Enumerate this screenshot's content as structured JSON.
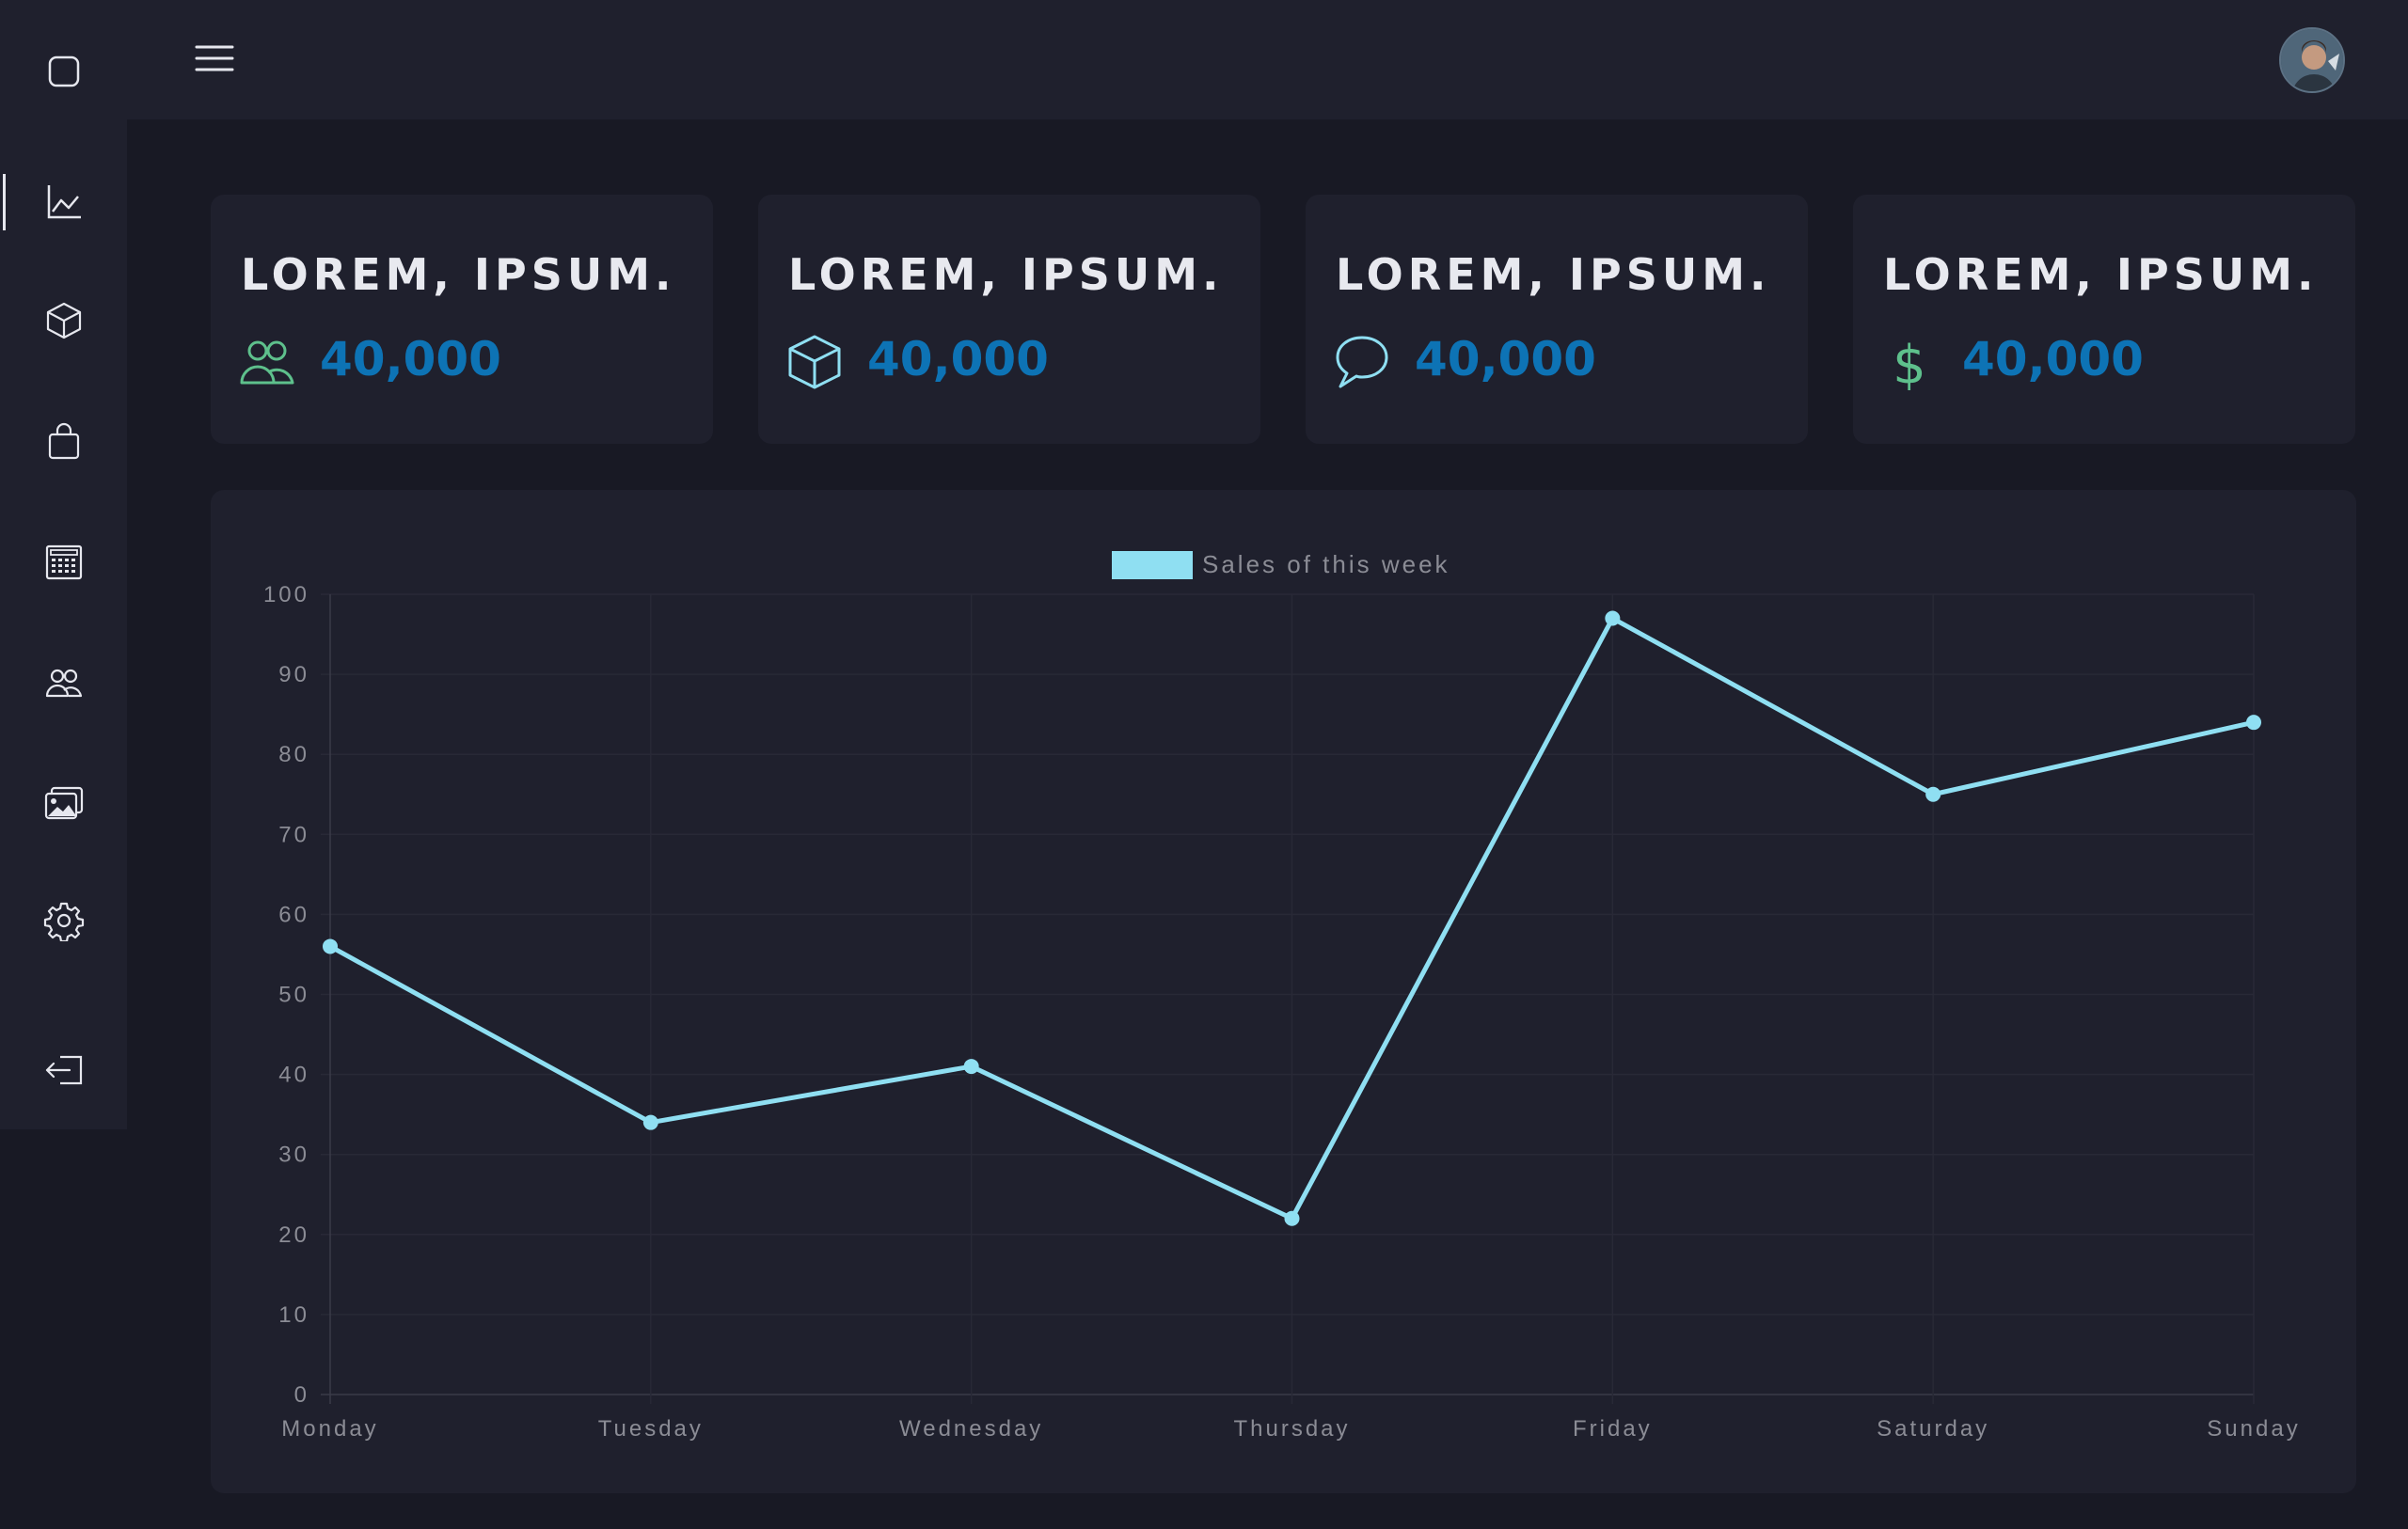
{
  "sidebar": {
    "items": [
      {
        "icon": "square-logo-icon"
      },
      {
        "icon": "line-chart-icon",
        "active": true
      },
      {
        "icon": "cube-icon"
      },
      {
        "icon": "shopping-bag-icon"
      },
      {
        "icon": "calculator-icon"
      },
      {
        "icon": "users-icon"
      },
      {
        "icon": "images-icon"
      },
      {
        "icon": "gear-icon"
      },
      {
        "icon": "logout-icon"
      }
    ]
  },
  "header": {
    "menu_icon": "hamburger-icon",
    "avatar": "user-avatar"
  },
  "cards": [
    {
      "title": "LOREM, IPSUM.",
      "value": "40,000",
      "icon": "users-icon",
      "icon_color": "#5ec08c"
    },
    {
      "title": "LOREM, IPSUM.",
      "value": "40,000",
      "icon": "cube-icon",
      "icon_color": "#8fdff2"
    },
    {
      "title": "LOREM, IPSUM.",
      "value": "40,000",
      "icon": "chat-bubble-icon",
      "icon_color": "#8fdff2"
    },
    {
      "title": "LOREM, IPSUM.",
      "value": "40,000",
      "icon": "dollar-icon",
      "icon_color": "#5ec08c"
    }
  ],
  "colors": {
    "background": "#181924",
    "panel": "#1f202d",
    "value_blue": "#0d73b5",
    "line": "#8fdff2",
    "text_muted": "#8b8c95"
  },
  "chart_data": {
    "type": "line",
    "categories": [
      "Monday",
      "Tuesday",
      "Wednesday",
      "Thursday",
      "Friday",
      "Saturday",
      "Sunday"
    ],
    "series": [
      {
        "name": "Sales of this week",
        "values": [
          56,
          34,
          41,
          22,
          97,
          75,
          84
        ]
      }
    ],
    "ylim": [
      0,
      100
    ],
    "yticks": [
      0,
      10,
      20,
      30,
      40,
      50,
      60,
      70,
      80,
      90,
      100
    ],
    "grid": true,
    "legend": "top-center"
  }
}
